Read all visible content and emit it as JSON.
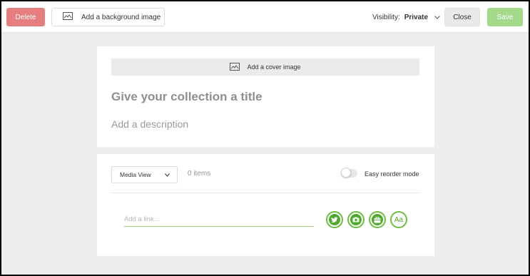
{
  "toolbar": {
    "delete_label": "Delete",
    "background_label": "Add a background image",
    "visibility_label": "Visibility:",
    "visibility_value": "Private",
    "close_label": "Close",
    "save_label": "Save"
  },
  "collection": {
    "cover_label": "Add a cover image",
    "title_placeholder": "Give your collection a title",
    "description_placeholder": "Add a description"
  },
  "items_panel": {
    "view_select": "Media View",
    "items_count": "0 items",
    "reorder_label": "Easy reorder mode",
    "link_placeholder": "Add a link...",
    "add_buttons": [
      {
        "name": "twitter",
        "icon": "twitter-icon"
      },
      {
        "name": "photo",
        "icon": "camera-icon"
      },
      {
        "name": "product",
        "icon": "bag-icon"
      },
      {
        "name": "text",
        "icon": "text-icon",
        "label": "Aa"
      }
    ]
  },
  "colors": {
    "delete": "#e67e80",
    "save": "#a5d98b",
    "accent_green": "#6bbf3f",
    "background": "#eeeeee"
  }
}
